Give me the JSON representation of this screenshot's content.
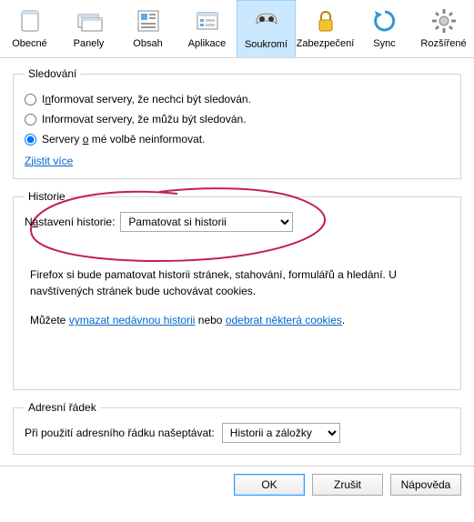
{
  "toolbar": {
    "items": [
      {
        "label": "Obecné",
        "icon": "general"
      },
      {
        "label": "Panely",
        "icon": "panels"
      },
      {
        "label": "Obsah",
        "icon": "content"
      },
      {
        "label": "Aplikace",
        "icon": "apps"
      },
      {
        "label": "Soukromí",
        "icon": "privacy",
        "active": true
      },
      {
        "label": "Zabezpečení",
        "icon": "security"
      },
      {
        "label": "Sync",
        "icon": "sync"
      },
      {
        "label": "Rozšířené",
        "icon": "advanced"
      }
    ]
  },
  "tracking": {
    "legend": "Sledování",
    "opt1_pre": "I",
    "opt1_key": "n",
    "opt1_post": "formovat servery, že nechci být sledován.",
    "opt2": "Informovat servery, že můžu být sledován.",
    "opt3_pre": "Servery ",
    "opt3_key": "o",
    "opt3_post": " mé volbě neinformovat.",
    "selected": "opt3",
    "more_pre": "Z",
    "more_key": "j",
    "more_post": "istit více"
  },
  "history": {
    "legend": "Historie",
    "label_pre": "N",
    "label_key": "a",
    "label_post": "stavení historie:",
    "selected": "Pamatovat si historii",
    "info1": "Firefox si bude pamatovat historii stránek, stahování, formulářů a hledání. U navštívených stránek bude uchovávat cookies.",
    "info2_pre": "Můžete ",
    "info2_link1": "vymazat nedávnou historii",
    "info2_mid": " nebo ",
    "info2_link2": "odebrat některá cookies",
    "info2_post": "."
  },
  "addressbar": {
    "legend": "Adresní řádek",
    "label": "Při použití adresního řádku našeptávat:",
    "selected": "Historii a záložky"
  },
  "buttons": {
    "ok": "OK",
    "cancel": "Zrušit",
    "help": "Nápověda"
  }
}
